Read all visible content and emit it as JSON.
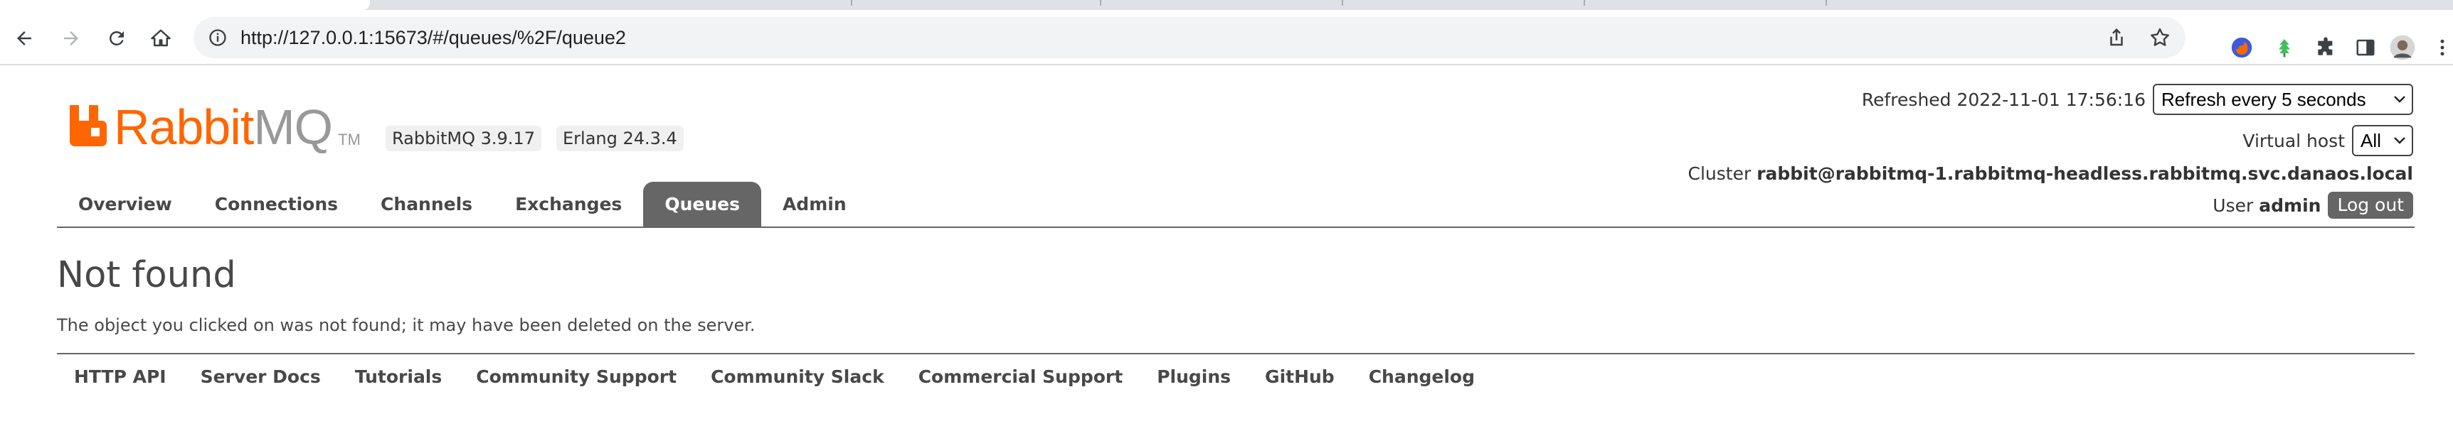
{
  "browser": {
    "url": "http://127.0.0.1:15673/#/queues/%2F/queue2",
    "icons": [
      "back-icon",
      "forward-icon",
      "reload-icon",
      "home-icon",
      "site-info-icon",
      "share-icon",
      "bookmark-star-icon",
      "firefox-extension-icon",
      "green-leaf-extension-icon",
      "puzzle-extensions-icon",
      "side-panel-icon",
      "profile-avatar-icon",
      "kebab-menu-icon"
    ]
  },
  "header": {
    "logo": {
      "rabbit": "Rabbit",
      "mq": "MQ",
      "tm": "TM"
    },
    "rabbitmq_version": "RabbitMQ 3.9.17",
    "erlang_version": "Erlang 24.3.4",
    "refreshed_text": "Refreshed 2022-11-01 17:56:16",
    "refresh_select_value": "Refresh every 5 seconds",
    "vhost_label": "Virtual host",
    "vhost_select_value": "All",
    "cluster_label": "Cluster",
    "cluster_name": "rabbit@rabbitmq-1.rabbitmq-headless.rabbitmq.svc.danaos.local",
    "user_label": "User",
    "user_name": "admin",
    "logout_label": "Log out"
  },
  "nav": {
    "tabs": [
      {
        "label": "Overview",
        "active": false
      },
      {
        "label": "Connections",
        "active": false
      },
      {
        "label": "Channels",
        "active": false
      },
      {
        "label": "Exchanges",
        "active": false
      },
      {
        "label": "Queues",
        "active": true
      },
      {
        "label": "Admin",
        "active": false
      }
    ]
  },
  "main": {
    "title": "Not found",
    "message": "The object you clicked on was not found; it may have been deleted on the server."
  },
  "footer": {
    "links": [
      "HTTP API",
      "Server Docs",
      "Tutorials",
      "Community Support",
      "Community Slack",
      "Commercial Support",
      "Plugins",
      "GitHub",
      "Changelog"
    ]
  },
  "colors": {
    "brand_orange": "#ff6600",
    "logo_grey": "#999999",
    "nav_active_bg": "#666666",
    "text": "#484848"
  }
}
